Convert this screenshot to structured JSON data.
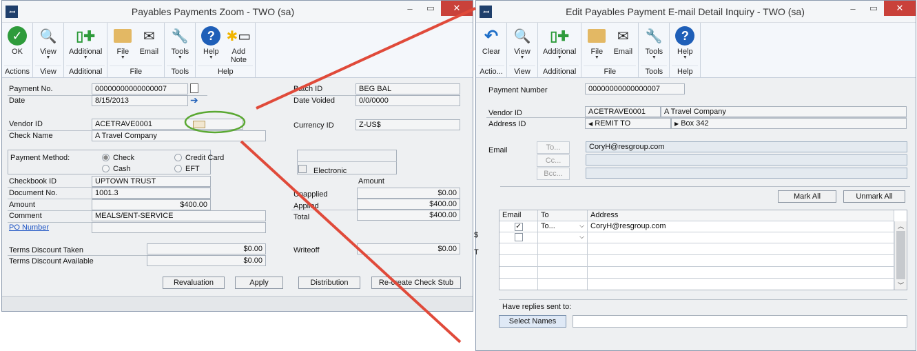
{
  "w1": {
    "title": "Payables Payments Zoom  -  TWO (sa)",
    "ribbon": [
      {
        "label": "Actions",
        "buttons": [
          "OK"
        ]
      },
      {
        "label": "View",
        "buttons": [
          "View"
        ]
      },
      {
        "label": "Additional",
        "buttons": [
          "Additional"
        ]
      },
      {
        "label": "File",
        "buttons": [
          "File",
          "Email"
        ]
      },
      {
        "label": "Tools",
        "buttons": [
          "Tools"
        ]
      },
      {
        "label": "Help",
        "buttons": [
          "Help",
          "Add Note"
        ]
      }
    ],
    "payment_no_label": "Payment No.",
    "payment_no": "00000000000000007",
    "date_label": "Date",
    "date": "8/15/2013",
    "batch_id_label": "Batch ID",
    "batch_id": "BEG BAL",
    "date_voided_label": "Date Voided",
    "date_voided": "0/0/0000",
    "vendor_id_label": "Vendor ID",
    "vendor_id": "ACETRAVE0001",
    "check_name_label": "Check Name",
    "check_name": "A Travel Company",
    "currency_id_label": "Currency ID",
    "currency_id": "Z-US$",
    "payment_method_label": "Payment Method:",
    "pm_check": "Check",
    "pm_credit": "Credit Card",
    "pm_cash": "Cash",
    "pm_eft": "EFT",
    "electronic": "Electronic",
    "checkbook_label": "Checkbook ID",
    "checkbook": "UPTOWN TRUST",
    "amount_header": "Amount",
    "document_label": "Document No.",
    "document": "1001.3",
    "amount_label": "Amount",
    "amount": "$400.00",
    "comment_label": "Comment",
    "comment": "MEALS/ENT-SERVICE",
    "po_label": "PO Number",
    "unapplied_label": "Unapplied",
    "unapplied": "$0.00",
    "applied_label": "Applied",
    "applied": "$400.00",
    "total_label": "Total",
    "total": "$400.00",
    "terms_taken_label": "Terms Discount Taken",
    "terms_taken": "$0.00",
    "terms_avail_label": "Terms Discount Available",
    "terms_avail": "$0.00",
    "writeoff_label": "Writeoff",
    "writeoff": "$0.00",
    "btn_revaluation": "Revaluation",
    "btn_apply": "Apply",
    "btn_distribution": "Distribution",
    "btn_recreate": "Re-create Check Stub"
  },
  "w2": {
    "title": "Edit Payables Payment E-mail Detail Inquiry  -  TWO (sa)",
    "ribbon": [
      {
        "label": "Actio...",
        "buttons": [
          "Clear"
        ]
      },
      {
        "label": "View",
        "buttons": [
          "View"
        ]
      },
      {
        "label": "Additional",
        "buttons": [
          "Additional"
        ]
      },
      {
        "label": "File",
        "buttons": [
          "File",
          "Email"
        ]
      },
      {
        "label": "Tools",
        "buttons": [
          "Tools"
        ]
      },
      {
        "label": "Help",
        "buttons": [
          "Help"
        ]
      }
    ],
    "payment_number_label": "Payment Number",
    "payment_number": "00000000000000007",
    "vendor_id_label": "Vendor ID",
    "vendor_id": "ACETRAVE0001",
    "vendor_name": "A Travel Company",
    "address_id_label": "Address ID",
    "address_id": "REMIT TO",
    "address_line": "Box 342",
    "email_label": "Email",
    "to_btn": "To...",
    "cc_btn": "Cc...",
    "bcc_btn": "Bcc...",
    "to_value": "CoryH@resgroup.com",
    "mark_all": "Mark All",
    "unmark_all": "Unmark All",
    "grid_headers": [
      "Email",
      "To",
      "Address"
    ],
    "grid_rows": [
      {
        "checked": true,
        "to": "To...",
        "address": "CoryH@resgroup.com"
      },
      {
        "checked": false,
        "to": "",
        "address": ""
      }
    ],
    "replies_label": "Have replies sent to:",
    "select_names": "Select Names"
  },
  "colors": {
    "annotation_red": "#e04a3a",
    "annotation_green": "#5aa832",
    "accent": "#1d54c4"
  }
}
